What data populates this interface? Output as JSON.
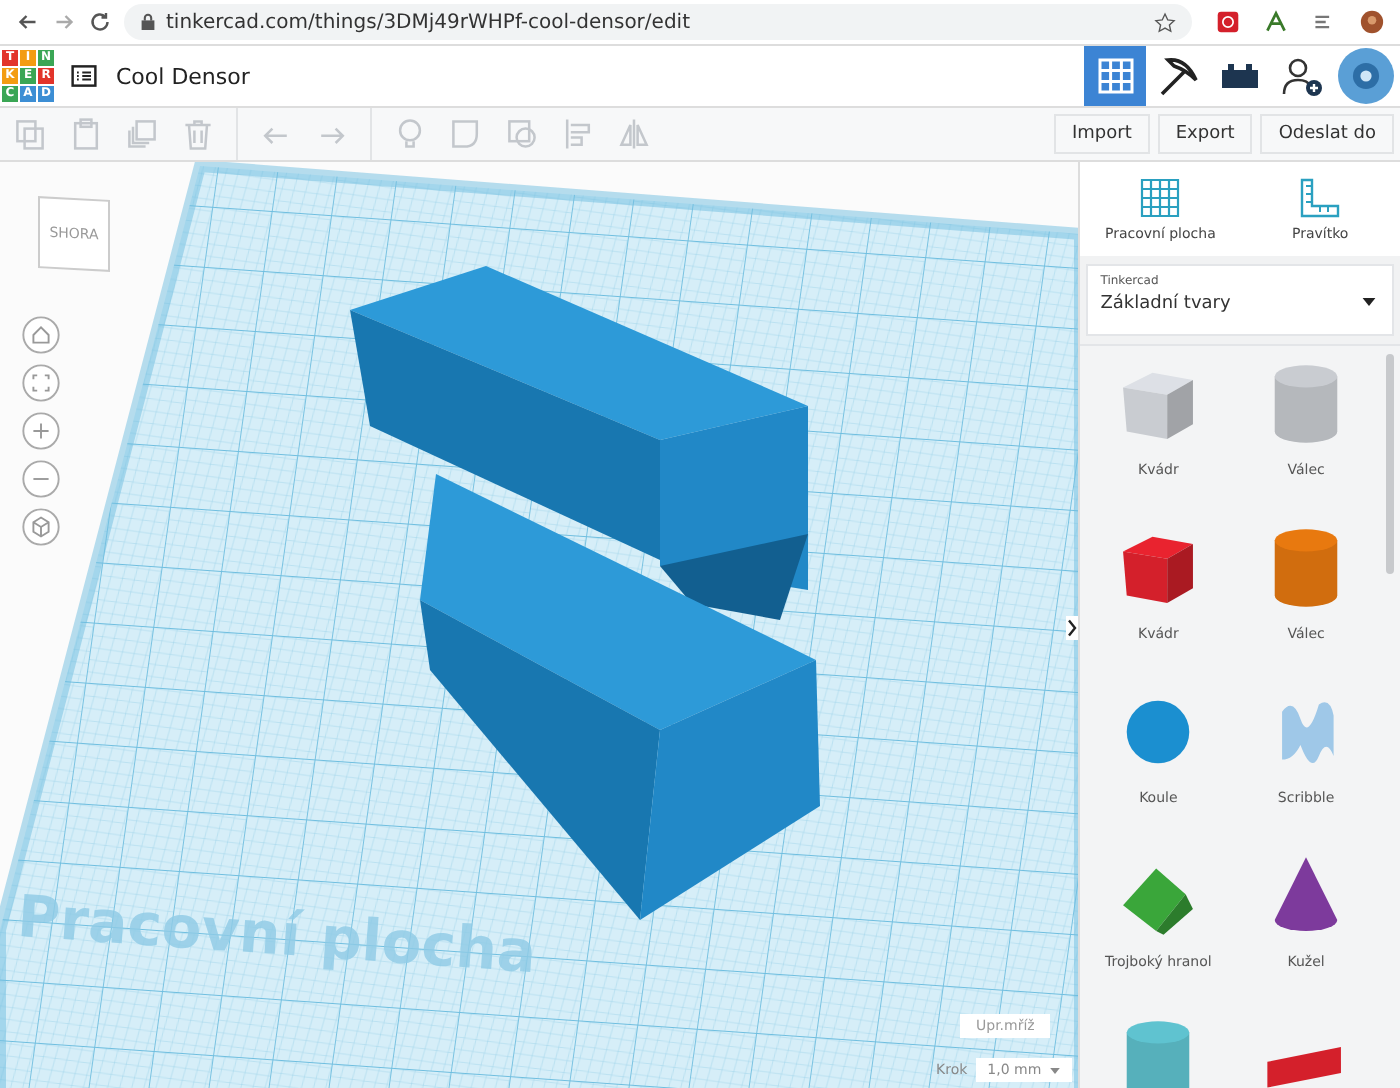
{
  "browser": {
    "url": "tinkercad.com/things/3DMj49rWHPf-cool-densor/edit"
  },
  "header": {
    "logo_letters": [
      {
        "letter": "T",
        "color": "#e2342b"
      },
      {
        "letter": "I",
        "color": "#f39c12"
      },
      {
        "letter": "N",
        "color": "#3aa655"
      },
      {
        "letter": "K",
        "color": "#f39c12"
      },
      {
        "letter": "E",
        "color": "#3aa655"
      },
      {
        "letter": "R",
        "color": "#e2342b"
      },
      {
        "letter": "C",
        "color": "#3aa655"
      },
      {
        "letter": "A",
        "color": "#3c8ed4"
      },
      {
        "letter": "D",
        "color": "#3c8ed4"
      }
    ],
    "title": "Cool Densor",
    "views": [
      {
        "kind": "grid",
        "selected": true
      },
      {
        "kind": "pickaxe",
        "selected": false
      },
      {
        "kind": "bricks",
        "selected": false
      }
    ]
  },
  "toolbar": {
    "tools": [
      {
        "kind": "copy",
        "disabled": true
      },
      {
        "kind": "paste",
        "disabled": true
      },
      {
        "kind": "duplicate",
        "disabled": true
      },
      {
        "kind": "delete",
        "disabled": true
      },
      {
        "kind": "undo",
        "disabled": true
      },
      {
        "kind": "redo",
        "disabled": true
      },
      {
        "kind": "bulb",
        "disabled": true
      },
      {
        "kind": "solid",
        "disabled": true
      },
      {
        "kind": "hole",
        "disabled": true
      },
      {
        "kind": "align",
        "disabled": true
      },
      {
        "kind": "mirror",
        "disabled": true
      }
    ],
    "buttons": [
      "Import",
      "Export",
      "Odeslat do"
    ]
  },
  "viewport": {
    "view_cube": "SHORA",
    "workplane_label": "Pracovní plocha",
    "edit_grid": "Upr.mříž",
    "snap": {
      "label": "Krok",
      "value": "1,0 mm"
    }
  },
  "panel": {
    "tabs": [
      "Pracovní plocha",
      "Pravítko"
    ],
    "library": {
      "label": "Tinkercad",
      "value": "Základní tvary"
    },
    "shapes": [
      {
        "kind": "box",
        "color": "#c9ccd1",
        "label": "Kvádr"
      },
      {
        "kind": "cylinder",
        "color": "#c9ccd1",
        "label": "Válec"
      },
      {
        "kind": "box",
        "color": "#d4202b",
        "label": "Kvádr"
      },
      {
        "kind": "cylinder",
        "color": "#e8790f",
        "label": "Válec"
      },
      {
        "kind": "sphere",
        "color": "#1b8fd0",
        "label": "Koule"
      },
      {
        "kind": "scribble",
        "color": "#9fc8e8",
        "label": "Scribble"
      },
      {
        "kind": "prism",
        "color": "#3aa63a",
        "label": "Trojboký hranol"
      },
      {
        "kind": "cone",
        "color": "#7d3a9c",
        "label": "Kužel"
      },
      {
        "kind": "cylinder",
        "color": "#5fc3d0"
      },
      {
        "kind": "text",
        "color": "#d4202b"
      }
    ]
  }
}
